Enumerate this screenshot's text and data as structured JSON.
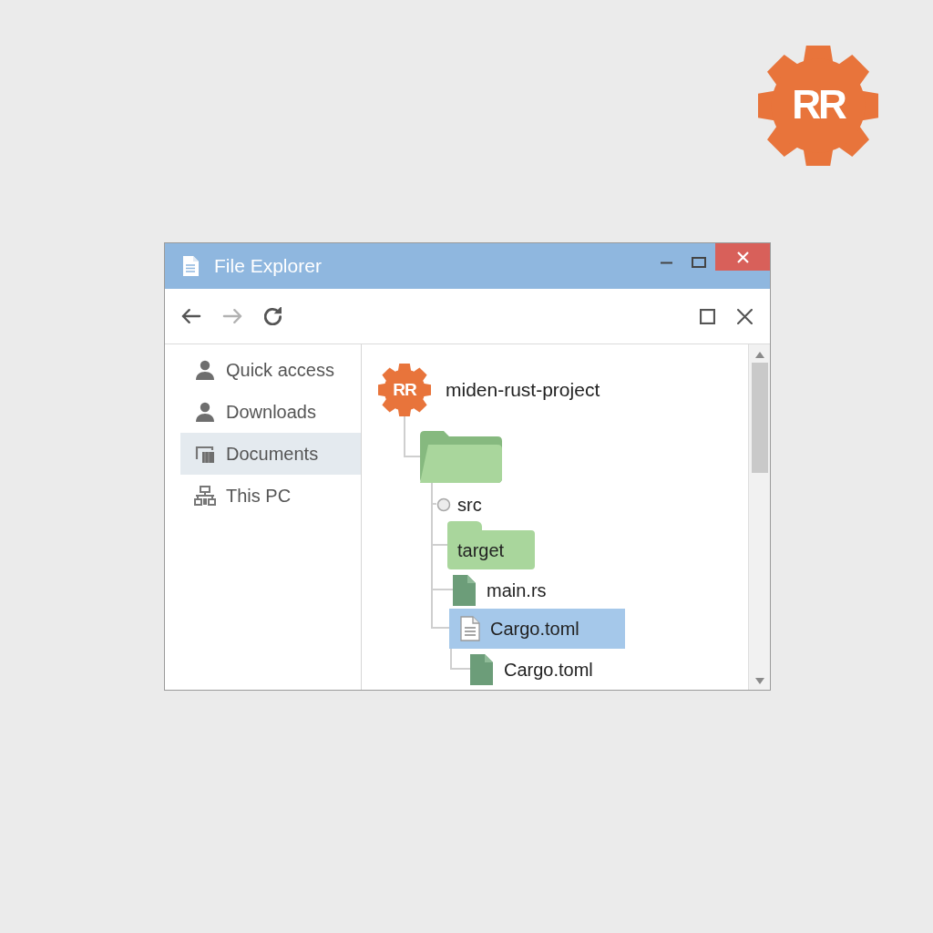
{
  "logo": {
    "text": "RR"
  },
  "window": {
    "title": "File Explorer"
  },
  "toolbar": {
    "nav": [
      {
        "kind": "back",
        "disabled": false
      },
      {
        "kind": "forward",
        "disabled": true
      },
      {
        "kind": "refresh",
        "disabled": false
      }
    ],
    "view": [
      {
        "kind": "maximize",
        "disabled": false
      },
      {
        "kind": "close",
        "disabled": false
      }
    ]
  },
  "sidebar": {
    "items": [
      {
        "kind": "person",
        "label": "Quick access",
        "selected": false
      },
      {
        "kind": "person",
        "label": "Downloads",
        "selected": false
      },
      {
        "kind": "documents",
        "label": "Documents",
        "selected": true
      },
      {
        "kind": "network",
        "label": "This PC",
        "selected": false
      }
    ]
  },
  "tree": {
    "kind": "project",
    "badge": "RR",
    "label": "miden-rust-project",
    "selected": false,
    "children": [
      {
        "kind": "folder",
        "selected": false,
        "children": [
          {
            "kind": "node",
            "label": "src",
            "selected": false
          },
          {
            "kind": "folder",
            "label": "target",
            "selected": false
          },
          {
            "kind": "file",
            "label": "main.rs",
            "selected": false
          },
          {
            "kind": "document",
            "label": "Cargo.toml",
            "selected": true,
            "children": [
              {
                "kind": "file",
                "label": "Cargo.toml",
                "selected": false
              }
            ]
          }
        ]
      }
    ]
  }
}
